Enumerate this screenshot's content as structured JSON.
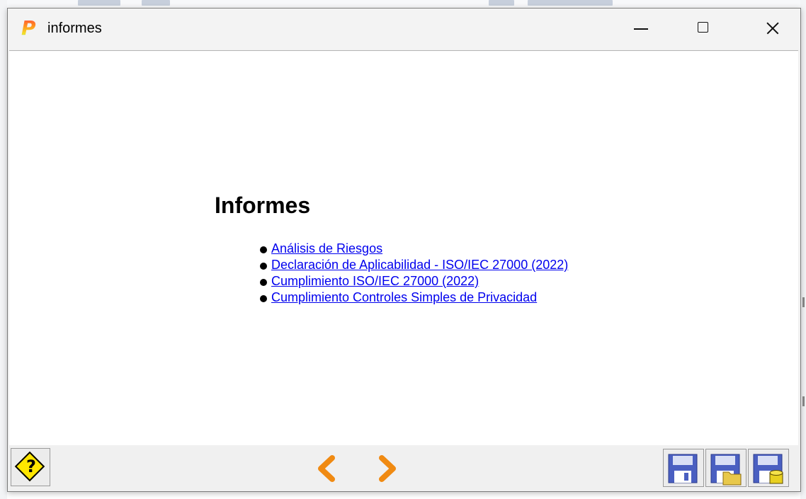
{
  "window": {
    "title": "informes",
    "app_icon_letter": "P",
    "controls": [
      "minimize-icon",
      "maximize-icon",
      "close-icon"
    ]
  },
  "content": {
    "heading": "Informes",
    "reports": [
      {
        "label": "Análisis de Riesgos"
      },
      {
        "label": "Declaración de Aplicabilidad - ISO/IEC 27000 (2022)"
      },
      {
        "label": "Cumplimiento ISO/IEC 27000 (2022)"
      },
      {
        "label": "Cumplimiento Controles Simples de Privacidad"
      }
    ]
  },
  "toolbar": {
    "help_symbol": "?",
    "help_icon": "help-diamond-icon",
    "prev_icon": "chevron-left-icon",
    "next_icon": "chevron-right-icon",
    "save_icons": [
      "floppy-save-icon",
      "floppy-folder-icon",
      "floppy-database-icon"
    ],
    "colors": {
      "accent_orange": "#f08a12",
      "help_yellow": "#ffe600",
      "floppy_blue": "#4a5fc1",
      "link_blue": "#0000ee"
    }
  }
}
